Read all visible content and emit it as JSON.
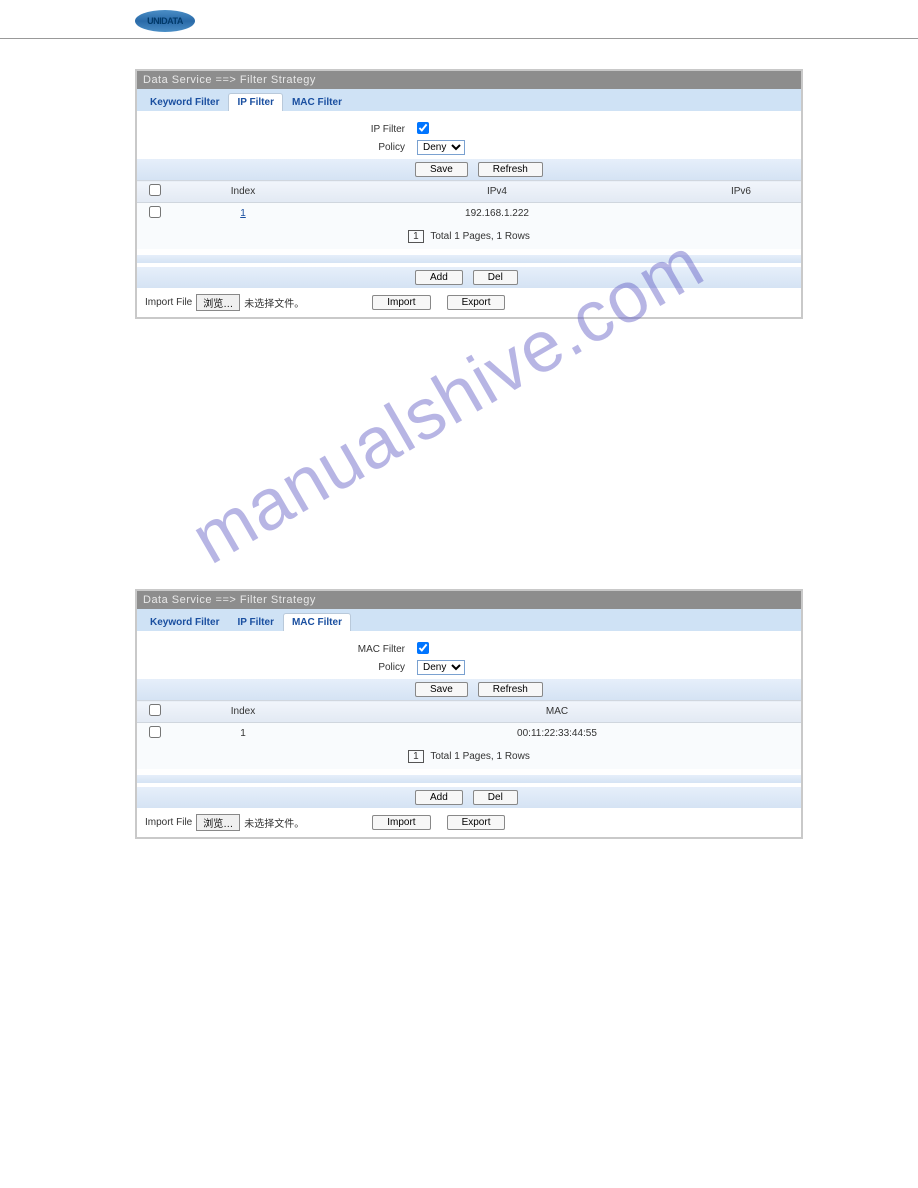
{
  "header": {
    "logo_text": "UNIDATA"
  },
  "watermark": "manualshive.com",
  "panel_title": "Data Service ==> Filter Strategy",
  "tabs": {
    "keyword": "Keyword Filter",
    "ip": "IP Filter",
    "mac": "MAC Filter"
  },
  "labels": {
    "ip_filter": "IP Filter",
    "mac_filter": "MAC Filter",
    "policy": "Policy",
    "import_file": "Import File",
    "no_file": "未选择文件。",
    "browse": "浏览…"
  },
  "policy": {
    "selected": "Deny"
  },
  "buttons": {
    "save": "Save",
    "refresh": "Refresh",
    "add": "Add",
    "del": "Del",
    "import": "Import",
    "export": "Export"
  },
  "ip_table": {
    "headers": {
      "index": "Index",
      "ipv4": "IPv4",
      "ipv6": "IPv6"
    },
    "rows": [
      {
        "index": "1",
        "ipv4": "192.168.1.222",
        "ipv6": ""
      }
    ]
  },
  "mac_table": {
    "headers": {
      "index": "Index",
      "mac": "MAC"
    },
    "rows": [
      {
        "index": "1",
        "mac": "00:11:22:33:44:55"
      }
    ]
  },
  "pager": {
    "page": "1",
    "summary": "Total 1 Pages, 1 Rows"
  }
}
